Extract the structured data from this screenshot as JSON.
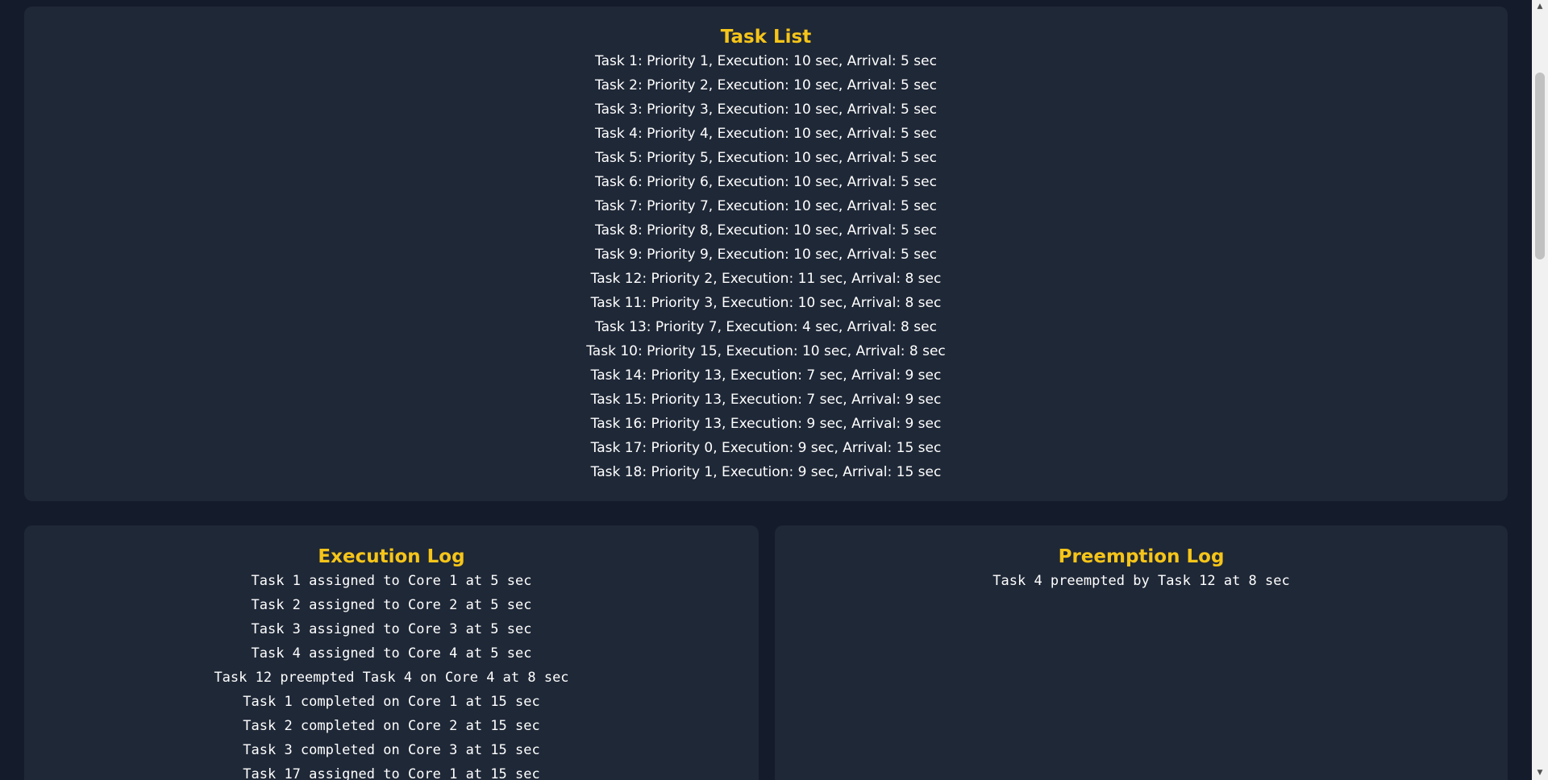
{
  "task_list": {
    "title": "Task List",
    "items": [
      "Task 1: Priority 1, Execution: 10 sec, Arrival: 5 sec",
      "Task 2: Priority 2, Execution: 10 sec, Arrival: 5 sec",
      "Task 3: Priority 3, Execution: 10 sec, Arrival: 5 sec",
      "Task 4: Priority 4, Execution: 10 sec, Arrival: 5 sec",
      "Task 5: Priority 5, Execution: 10 sec, Arrival: 5 sec",
      "Task 6: Priority 6, Execution: 10 sec, Arrival: 5 sec",
      "Task 7: Priority 7, Execution: 10 sec, Arrival: 5 sec",
      "Task 8: Priority 8, Execution: 10 sec, Arrival: 5 sec",
      "Task 9: Priority 9, Execution: 10 sec, Arrival: 5 sec",
      "Task 12: Priority 2, Execution: 11 sec, Arrival: 8 sec",
      "Task 11: Priority 3, Execution: 10 sec, Arrival: 8 sec",
      "Task 13: Priority 7, Execution: 4 sec, Arrival: 8 sec",
      "Task 10: Priority 15, Execution: 10 sec, Arrival: 8 sec",
      "Task 14: Priority 13, Execution: 7 sec, Arrival: 9 sec",
      "Task 15: Priority 13, Execution: 7 sec, Arrival: 9 sec",
      "Task 16: Priority 13, Execution: 9 sec, Arrival: 9 sec",
      "Task 17: Priority 0, Execution: 9 sec, Arrival: 15 sec",
      "Task 18: Priority 1, Execution: 9 sec, Arrival: 15 sec"
    ]
  },
  "execution_log": {
    "title": "Execution Log",
    "entries": [
      "Task 1 assigned to Core 1 at 5 sec",
      "Task 2 assigned to Core 2 at 5 sec",
      "Task 3 assigned to Core 3 at 5 sec",
      "Task 4 assigned to Core 4 at 5 sec",
      "Task 12 preempted Task 4 on Core 4 at 8 sec",
      "Task 1 completed on Core 1 at 15 sec",
      "Task 2 completed on Core 2 at 15 sec",
      "Task 3 completed on Core 3 at 15 sec",
      "Task 17 assigned to Core 1 at 15 sec"
    ]
  },
  "preemption_log": {
    "title": "Preemption Log",
    "entries": [
      "Task 4 preempted by Task 12 at 8 sec"
    ]
  },
  "scrollbar": {
    "up_icon": "arrow-up-icon",
    "down_icon": "arrow-down-icon"
  },
  "colors": {
    "background": "#141b2b",
    "panel": "#1f2837",
    "heading": "#f6c519",
    "text": "#ffffff"
  }
}
